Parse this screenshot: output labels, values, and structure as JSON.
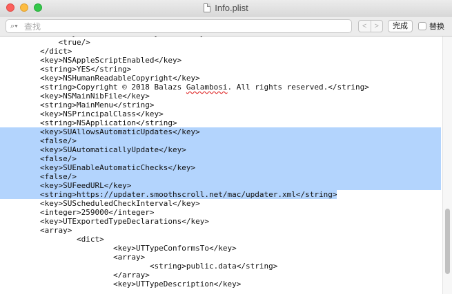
{
  "window": {
    "title": "Info.plist"
  },
  "find_bar": {
    "search_placeholder": "查找",
    "prev_label": "<",
    "next_label": ">",
    "done_label": "完成",
    "replace_label": "替换"
  },
  "editor": {
    "lines": [
      {
        "indent": "            ",
        "text": "<key>NSAllowsArbitraryLoads</key>",
        "selected": false
      },
      {
        "indent": "            ",
        "text": "<true/>",
        "selected": false
      },
      {
        "indent": "        ",
        "text": "</dict>",
        "selected": false
      },
      {
        "indent": "        ",
        "text": "<key>NSAppleScriptEnabled</key>",
        "selected": false
      },
      {
        "indent": "        ",
        "text": "<string>YES</string>",
        "selected": false
      },
      {
        "indent": "        ",
        "text": "<key>NSHumanReadableCopyright</key>",
        "selected": false
      },
      {
        "indent": "        ",
        "text": "<string>Copyright © 2018 Balazs Galambosi. All rights reserved.</string>",
        "selected": false
      },
      {
        "indent": "        ",
        "text": "<key>NSMainNibFile</key>",
        "selected": false
      },
      {
        "indent": "        ",
        "text": "<string>MainMenu</string>",
        "selected": false
      },
      {
        "indent": "        ",
        "text": "<key>NSPrincipalClass</key>",
        "selected": false
      },
      {
        "indent": "        ",
        "text": "<string>NSApplication</string>",
        "selected": false
      },
      {
        "indent": "        ",
        "text": "<key>SUAllowsAutomaticUpdates</key>",
        "selected": true
      },
      {
        "indent": "        ",
        "text": "<false/>",
        "selected": true
      },
      {
        "indent": "        ",
        "text": "<key>SUAutomaticallyUpdate</key>",
        "selected": true
      },
      {
        "indent": "        ",
        "text": "<false/>",
        "selected": true
      },
      {
        "indent": "        ",
        "text": "<key>SUEnableAutomaticChecks</key>",
        "selected": true
      },
      {
        "indent": "        ",
        "text": "<false/>",
        "selected": true
      },
      {
        "indent": "        ",
        "text": "<key>SUFeedURL</key>",
        "selected": true
      },
      {
        "indent": "        ",
        "text": "<string>https://updater.smoothscroll.net/mac/updater.xml</string>",
        "selected": "partial"
      },
      {
        "indent": "        ",
        "text": "<key>SUScheduledCheckInterval</key>",
        "selected": false
      },
      {
        "indent": "        ",
        "text": "<integer>259000</integer>",
        "selected": false
      },
      {
        "indent": "        ",
        "text": "<key>UTExportedTypeDeclarations</key>",
        "selected": false
      },
      {
        "indent": "        ",
        "text": "<array>",
        "selected": false
      },
      {
        "indent": "                ",
        "text": "<dict>",
        "selected": false
      },
      {
        "indent": "                        ",
        "text": "<key>UTTypeConformsTo</key>",
        "selected": false
      },
      {
        "indent": "                        ",
        "text": "<array>",
        "selected": false
      },
      {
        "indent": "                                ",
        "text": "<string>public.data</string>",
        "selected": false
      },
      {
        "indent": "                        ",
        "text": "</array>",
        "selected": false
      },
      {
        "indent": "                        ",
        "text": "<key>UTTypeDescription</key>",
        "selected": false
      }
    ]
  }
}
